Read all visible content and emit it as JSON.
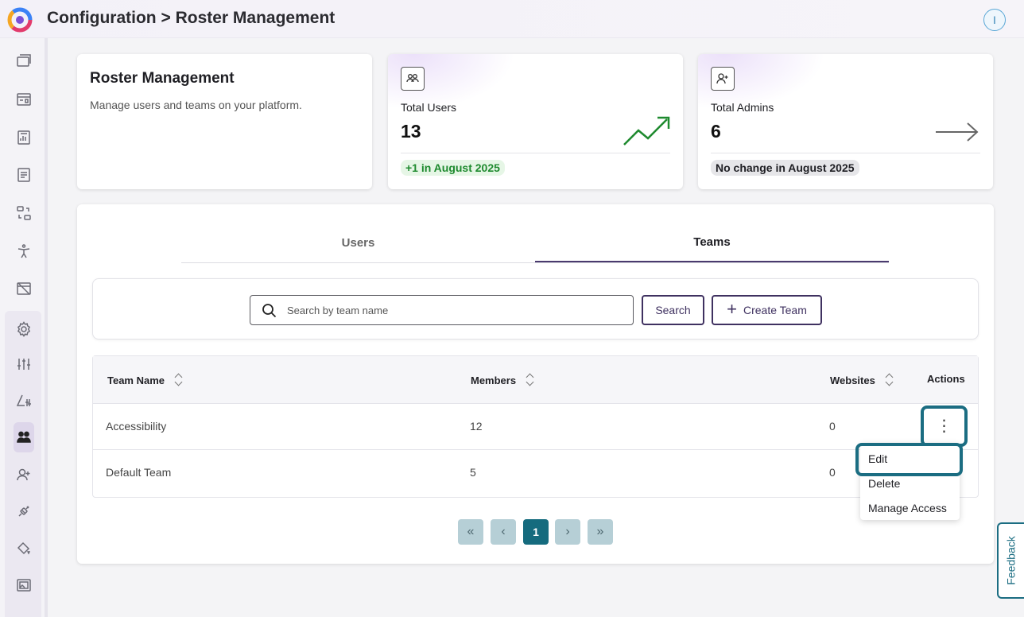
{
  "header": {
    "breadcrumb": "Configuration > Roster Management",
    "avatar_initial": "I"
  },
  "intro": {
    "title": "Roster Management",
    "description": "Manage users and teams on your platform."
  },
  "stats": {
    "users": {
      "label": "Total Users",
      "value": "13",
      "change": "+1 in August 2025",
      "trend": "up"
    },
    "admins": {
      "label": "Total Admins",
      "value": "6",
      "change": "No change in August 2025",
      "trend": "flat"
    }
  },
  "tabs": [
    {
      "label": "Users",
      "active": false
    },
    {
      "label": "Teams",
      "active": true
    }
  ],
  "search": {
    "placeholder": "Search by team name",
    "value": "",
    "button_label": "Search",
    "create_label": "Create Team"
  },
  "table": {
    "columns": [
      "Team Name",
      "Members",
      "Websites",
      "Actions"
    ],
    "rows": [
      {
        "name": "Accessibility",
        "members": "12",
        "websites": "0"
      },
      {
        "name": "Default Team",
        "members": "5",
        "websites": "0"
      }
    ]
  },
  "row_menu": {
    "items": [
      "Edit",
      "Delete",
      "Manage Access"
    ]
  },
  "pagination": {
    "first": "«",
    "prev": "‹",
    "current": "1",
    "next": "›",
    "last": "»"
  },
  "feedback_label": "Feedback",
  "colors": {
    "accent": "#3f3160",
    "teal": "#1b6d82",
    "positive": "#1e8a2e"
  }
}
